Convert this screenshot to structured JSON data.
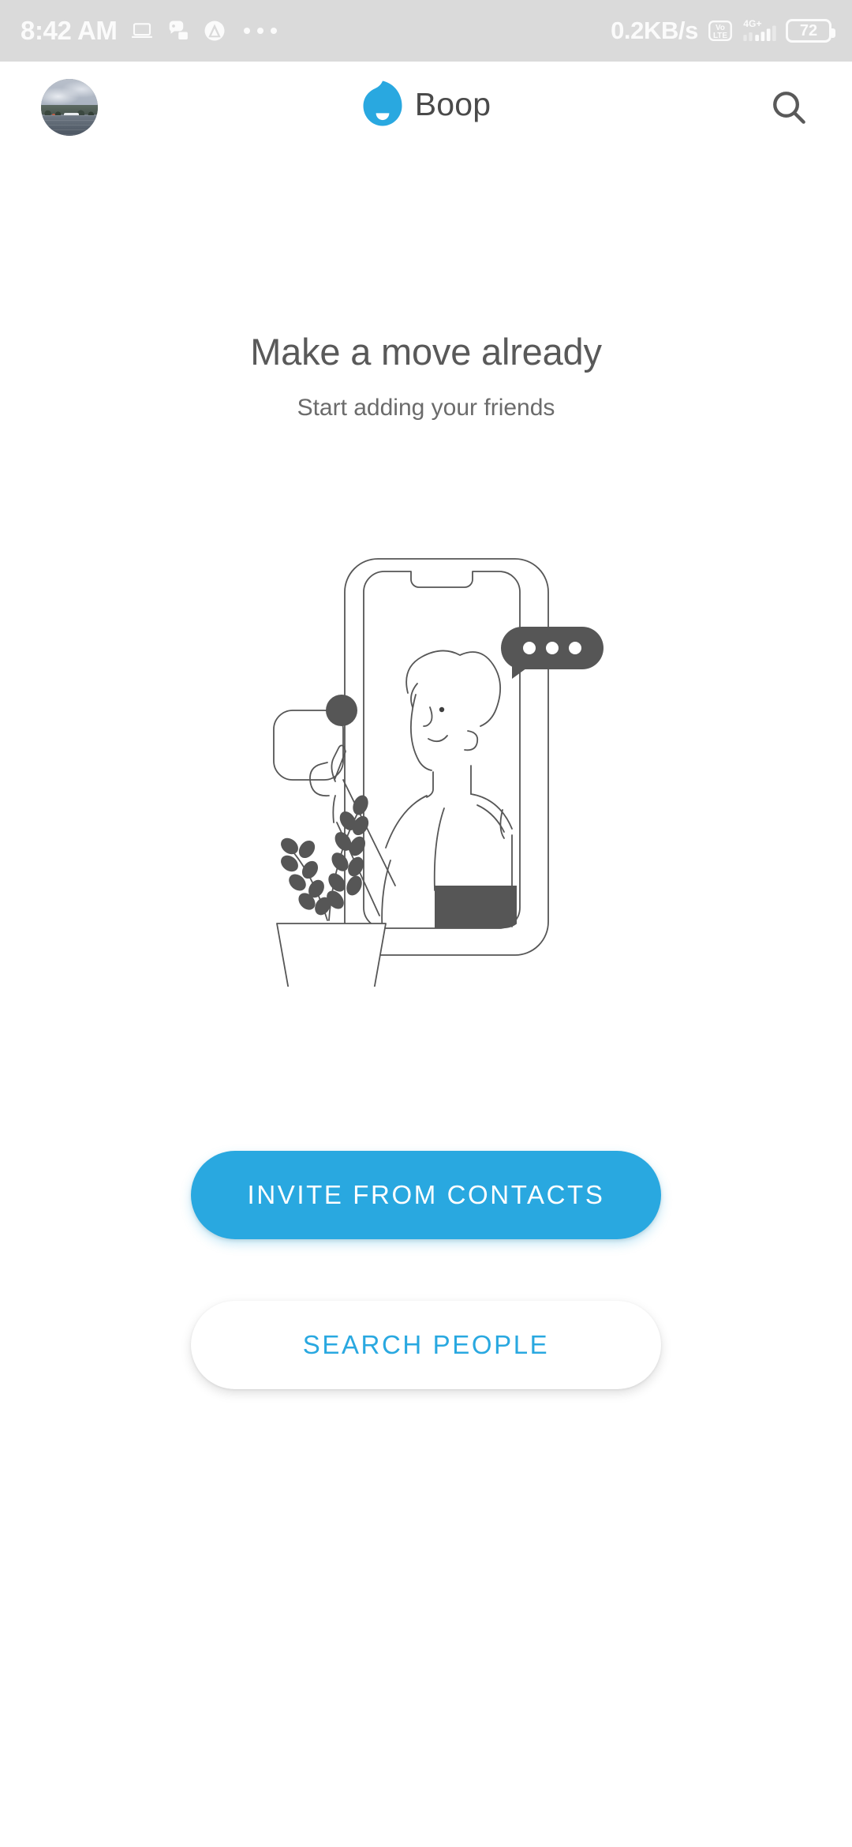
{
  "status_bar": {
    "time": "8:42 AM",
    "network_speed": "0.2KB/s",
    "volte_top": "Vo",
    "volte_bottom": "LTE",
    "network_type": "4G+",
    "battery_level": "72",
    "icons": [
      "laptop-icon",
      "chat-app-icon",
      "a-app-icon",
      "overflow-dots-icon"
    ]
  },
  "app_bar": {
    "avatar_label": "Profile photo",
    "brand_name": "Boop",
    "logo_icon": "boop-droplet-logo",
    "search_icon": "search-icon"
  },
  "empty_state": {
    "headline": "Make a move already",
    "subhead": "Start adding your friends",
    "illustration": "person-pointing-at-phone-illustration"
  },
  "actions": {
    "primary_label": "INVITE FROM CONTACTS",
    "secondary_label": "SEARCH PEOPLE"
  },
  "colors": {
    "accent": "#29a8e0",
    "status_bar_bg": "#dadada",
    "text_primary": "#595959",
    "text_secondary": "#6b6b6b",
    "illustration_stroke": "#565656"
  }
}
